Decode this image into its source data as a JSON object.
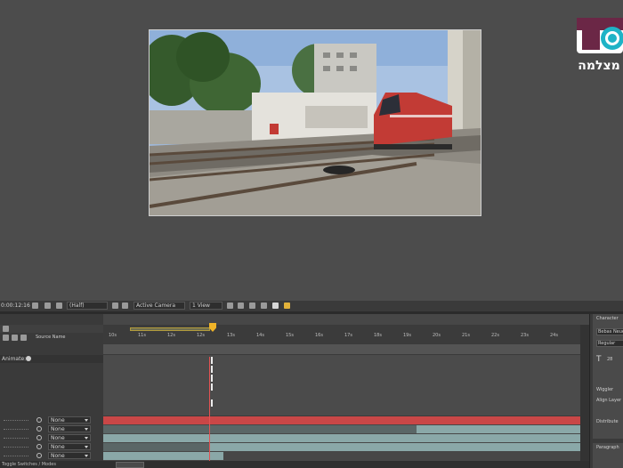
{
  "composition": {
    "camera": "Active Camera",
    "views": "1 View",
    "resolution": "(Half)",
    "timecode": "0:00:12:16"
  },
  "logo": {
    "text": "מצלמה",
    "accent": "#1fb3c6"
  },
  "timeline": {
    "source_name_header": "Source Name",
    "animate_label": "Animate:",
    "ruler": [
      "10s",
      "11s",
      "12s",
      "12s",
      "13s",
      "14s",
      "15s",
      "16s",
      "17s",
      "18s",
      "19s",
      "20s",
      "21s",
      "22s",
      "23s",
      "24s"
    ],
    "layers": [
      {
        "parent": "None"
      },
      {
        "parent": "None"
      },
      {
        "parent": "None"
      },
      {
        "parent": "None"
      },
      {
        "parent": "None"
      }
    ],
    "status": "Toggle Switches / Modes",
    "colors": {
      "track_red": "#c94747",
      "track_teal": "#8aa8a8",
      "cti": "#f0b428"
    }
  },
  "character_panel": {
    "title": "Character",
    "font": "Bebas Neue",
    "style": "Regular",
    "size_value": "28",
    "wiggler_title": "Wiggler",
    "align_label": "Align Layer",
    "distribute_label": "Distribute",
    "paragraph_label": "Paragraph"
  }
}
